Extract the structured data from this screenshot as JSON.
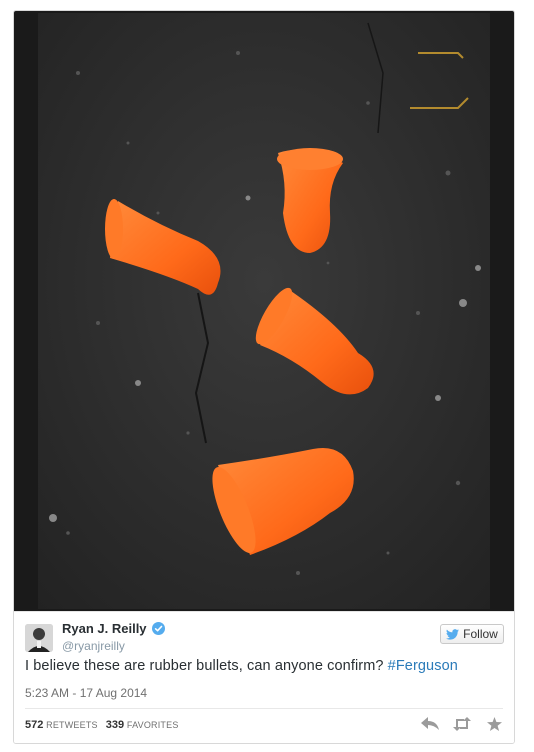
{
  "tweet": {
    "author_name": "Ryan J. Reilly",
    "author_handle": "@ryanjreilly",
    "text_before": "I believe these are rubber bullets, can anyone confirm? ",
    "hashtag": "#Ferguson",
    "timestamp": "5:23 AM - 17 Aug 2014",
    "follow_label": "Follow",
    "retweets_count": "572",
    "retweets_label": "RETWEETS",
    "favorites_count": "339",
    "favorites_label": "FAVORITES"
  },
  "colors": {
    "verified": "#55acee",
    "link": "#2b7bb9",
    "object": "#ff6a1a"
  },
  "icons": [
    "verified-badge-icon",
    "twitter-bird-icon",
    "reply-icon",
    "retweet-icon",
    "favorite-star-icon"
  ]
}
